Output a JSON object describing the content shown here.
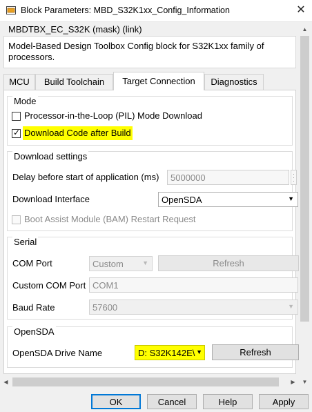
{
  "window": {
    "title": "Block Parameters: MBD_S32K1xx_Config_Information",
    "close_icon": "close-icon",
    "app_icon": "simulink-block-icon"
  },
  "header": {
    "mask_title": "MBDTBX_EC_S32K (mask) (link)",
    "description": "Model-Based Design Toolbox Config block for S32K1xx family of processors."
  },
  "tabs": [
    {
      "label": "MCU",
      "active": false
    },
    {
      "label": "Build Toolchain",
      "active": false
    },
    {
      "label": "Target Connection",
      "active": true
    },
    {
      "label": "Diagnostics",
      "active": false
    }
  ],
  "mode": {
    "title": "Mode",
    "pil_label": "Processor-in-the-Loop (PIL) Mode Download",
    "pil_checked": false,
    "download_label": "Download Code after Build",
    "download_checked": true
  },
  "download_settings": {
    "title": "Download settings",
    "delay_label": "Delay before start of application (ms)",
    "delay_value": "5000000",
    "interface_label": "Download Interface",
    "interface_value": "OpenSDA",
    "bam_label": "Boot Assist Module (BAM) Restart Request",
    "bam_checked": false
  },
  "serial": {
    "title": "Serial",
    "com_port_label": "COM Port",
    "com_port_value": "Custom",
    "refresh_label": "Refresh",
    "custom_com_label": "Custom COM Port",
    "custom_com_value": "COM1",
    "baud_label": "Baud Rate",
    "baud_value": "57600"
  },
  "opensda": {
    "title": "OpenSDA",
    "drive_label": "OpenSDA Drive Name",
    "drive_value": "D: S32K142E\\",
    "refresh_label": "Refresh"
  },
  "buttons": {
    "ok": "OK",
    "cancel": "Cancel",
    "help": "Help",
    "apply": "Apply"
  },
  "colors": {
    "highlight": "#ffff00",
    "focus_border": "#0078d7"
  }
}
